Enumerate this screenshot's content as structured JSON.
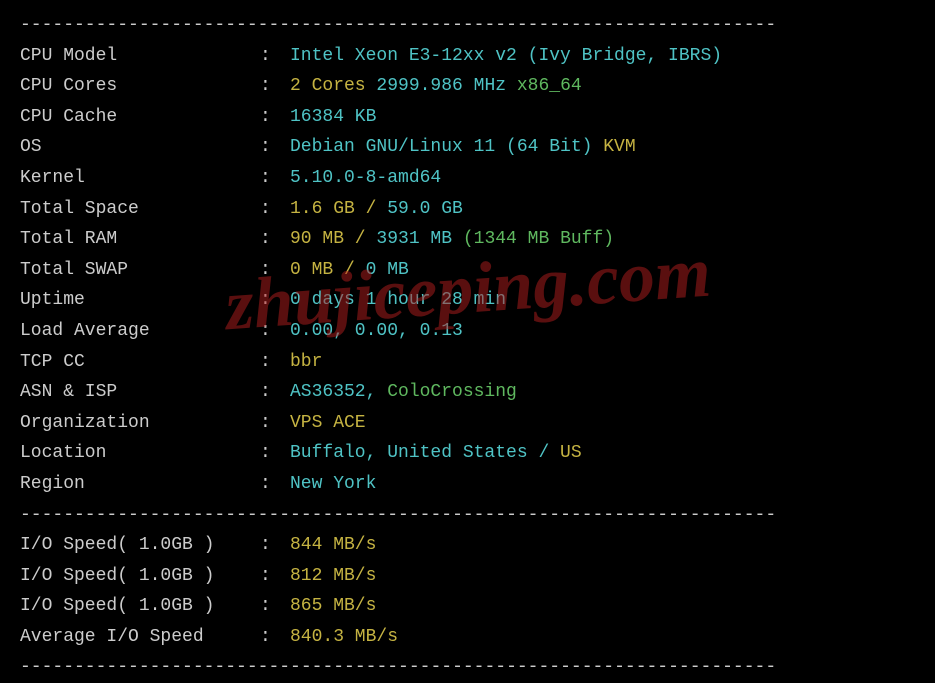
{
  "divider": "----------------------------------------------------------------------",
  "watermark": "zhujiceping.com",
  "rows": [
    {
      "label": "CPU Model",
      "segments": [
        {
          "text": "Intel Xeon E3-12xx v2 (Ivy Bridge, IBRS)",
          "cls": "cyan"
        }
      ]
    },
    {
      "label": "CPU Cores",
      "segments": [
        {
          "text": "2 Cores",
          "cls": "yellow"
        },
        {
          "text": " 2999.986 MHz ",
          "cls": "cyan"
        },
        {
          "text": "x86_64",
          "cls": "green"
        }
      ]
    },
    {
      "label": "CPU Cache",
      "segments": [
        {
          "text": "16384 KB",
          "cls": "cyan"
        }
      ]
    },
    {
      "label": "OS",
      "segments": [
        {
          "text": "Debian GNU/Linux 11 (64 Bit)",
          "cls": "cyan"
        },
        {
          "text": " KVM",
          "cls": "yellow"
        }
      ]
    },
    {
      "label": "Kernel",
      "segments": [
        {
          "text": "5.10.0-8-amd64",
          "cls": "cyan"
        }
      ]
    },
    {
      "label": "Total Space",
      "segments": [
        {
          "text": "1.6 GB / ",
          "cls": "yellow"
        },
        {
          "text": "59.0 GB",
          "cls": "cyan"
        }
      ]
    },
    {
      "label": "Total RAM",
      "segments": [
        {
          "text": "90 MB / ",
          "cls": "yellow"
        },
        {
          "text": "3931 MB",
          "cls": "cyan"
        },
        {
          "text": " (1344 MB Buff)",
          "cls": "green"
        }
      ]
    },
    {
      "label": "Total SWAP",
      "segments": [
        {
          "text": "0 MB / ",
          "cls": "yellow"
        },
        {
          "text": "0 MB",
          "cls": "cyan"
        }
      ]
    },
    {
      "label": "Uptime",
      "segments": [
        {
          "text": "0 days 1 hour 28 min",
          "cls": "cyan"
        }
      ]
    },
    {
      "label": "Load Average",
      "segments": [
        {
          "text": "0.00, 0.00, 0.13",
          "cls": "cyan"
        }
      ]
    },
    {
      "label": "TCP CC",
      "segments": [
        {
          "text": "bbr",
          "cls": "yellow"
        }
      ]
    },
    {
      "label": "ASN & ISP",
      "segments": [
        {
          "text": "AS36352, ",
          "cls": "cyan"
        },
        {
          "text": "ColoCrossing",
          "cls": "green"
        }
      ]
    },
    {
      "label": "Organization",
      "segments": [
        {
          "text": "VPS ACE",
          "cls": "yellow"
        }
      ]
    },
    {
      "label": "Location",
      "segments": [
        {
          "text": "Buffalo, United States / ",
          "cls": "cyan"
        },
        {
          "text": "US",
          "cls": "yellow"
        }
      ]
    },
    {
      "label": "Region",
      "segments": [
        {
          "text": "New York",
          "cls": "cyan"
        }
      ]
    }
  ],
  "io_rows": [
    {
      "label": "I/O Speed( 1.0GB )",
      "segments": [
        {
          "text": "844 MB/s",
          "cls": "yellow"
        }
      ]
    },
    {
      "label": "I/O Speed( 1.0GB )",
      "segments": [
        {
          "text": "812 MB/s",
          "cls": "yellow"
        }
      ]
    },
    {
      "label": "I/O Speed( 1.0GB )",
      "segments": [
        {
          "text": "865 MB/s",
          "cls": "yellow"
        }
      ]
    },
    {
      "label": "Average I/O Speed",
      "segments": [
        {
          "text": "840.3 MB/s",
          "cls": "yellow"
        }
      ]
    }
  ]
}
